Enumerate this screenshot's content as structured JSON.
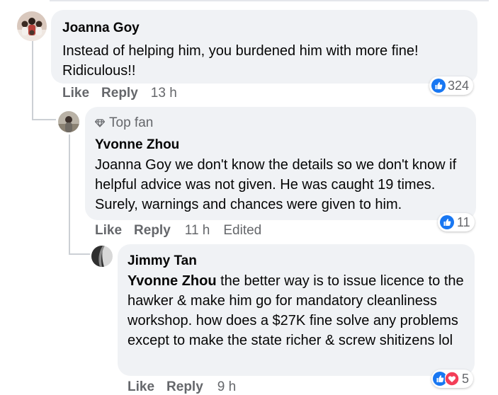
{
  "comments": [
    {
      "author": "Joanna Goy",
      "text": "Instead of helping him, you burdened him with more fine! Ridiculous!!",
      "reaction_count": "324",
      "actions": {
        "like": "Like",
        "reply": "Reply",
        "time": "13 h"
      }
    },
    {
      "badge": "Top fan",
      "author": "Yvonne Zhou",
      "mention": "Joanna Goy",
      "text": " we don't know the details so we don't know if helpful advice was not given. He was caught 19 times. Surely, warnings and chances were given to him.",
      "reaction_count": "11",
      "actions": {
        "like": "Like",
        "reply": "Reply",
        "time": "11 h",
        "edited": "Edited"
      }
    },
    {
      "author": "Jimmy Tan",
      "mention": "Yvonne Zhou",
      "text": " the better way is to issue licence to the hawker & make him go for mandatory cleanliness workshop. how does a $27K fine solve any problems except to make the state richer & screw shitizens lol",
      "reaction_count": "5",
      "actions": {
        "like": "Like",
        "reply": "Reply",
        "time": "9 h"
      }
    }
  ],
  "icons": {
    "like_reaction": "thumbs-up-icon",
    "love_reaction": "heart-icon",
    "top_fan": "diamond-icon"
  },
  "colors": {
    "like_blue": "#1877f2",
    "love_red": "#f33e58",
    "bubble_bg": "#f0f2f5",
    "secondary_text": "#65676b"
  }
}
